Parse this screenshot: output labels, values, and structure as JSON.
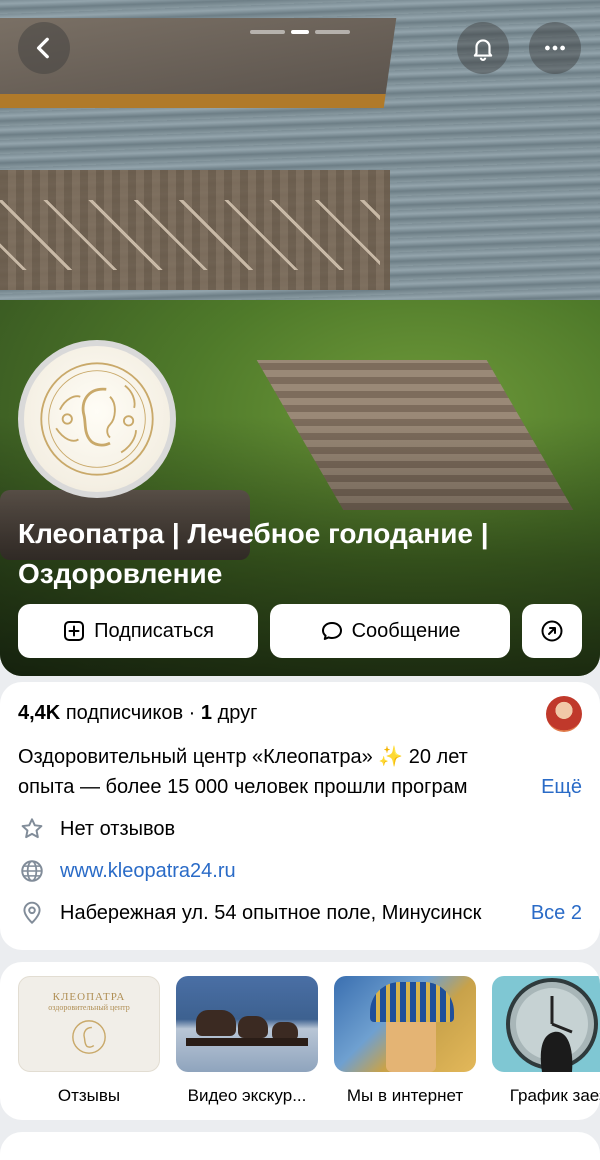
{
  "header": {
    "back_icon": "chevron-left-icon",
    "bell_icon": "bell-icon",
    "more_icon": "more-horizontal-icon",
    "cover_page_count": 3,
    "cover_active_page": 2
  },
  "community": {
    "name": "Клеопатра | Лечебное голодание | Оздоровление"
  },
  "actions": {
    "subscribe_label": "Подписаться",
    "message_label": "Сообщение",
    "share_icon": "arrow-up-right-circle-icon"
  },
  "info": {
    "subscribers": "4,4K",
    "subscribers_word": "подписчиков",
    "separator": "·",
    "friends": "1",
    "friends_word": "друг",
    "description_line1": "Оздоровительный центр «Клеопатра» ✨  20 лет",
    "description_line2": "опыта — более 15 000 человек прошли програм",
    "more_label": "Ещё",
    "reviews": "Нет отзывов",
    "website": "www.kleopatra24.ru",
    "address": "Набережная ул. 54 опытное поле, Минусинск",
    "address_all": "Все 2"
  },
  "highlights": [
    {
      "label": "Отзывы",
      "thumb_title": "КЛЕОПАТРА",
      "thumb_sub": "оздоровительный центр"
    },
    {
      "label": "Видео экскур..."
    },
    {
      "label": "Мы в интернет"
    },
    {
      "label": "График заезд"
    }
  ],
  "colors": {
    "accent": "#2a6bc7",
    "gold": "#c9a96a"
  }
}
